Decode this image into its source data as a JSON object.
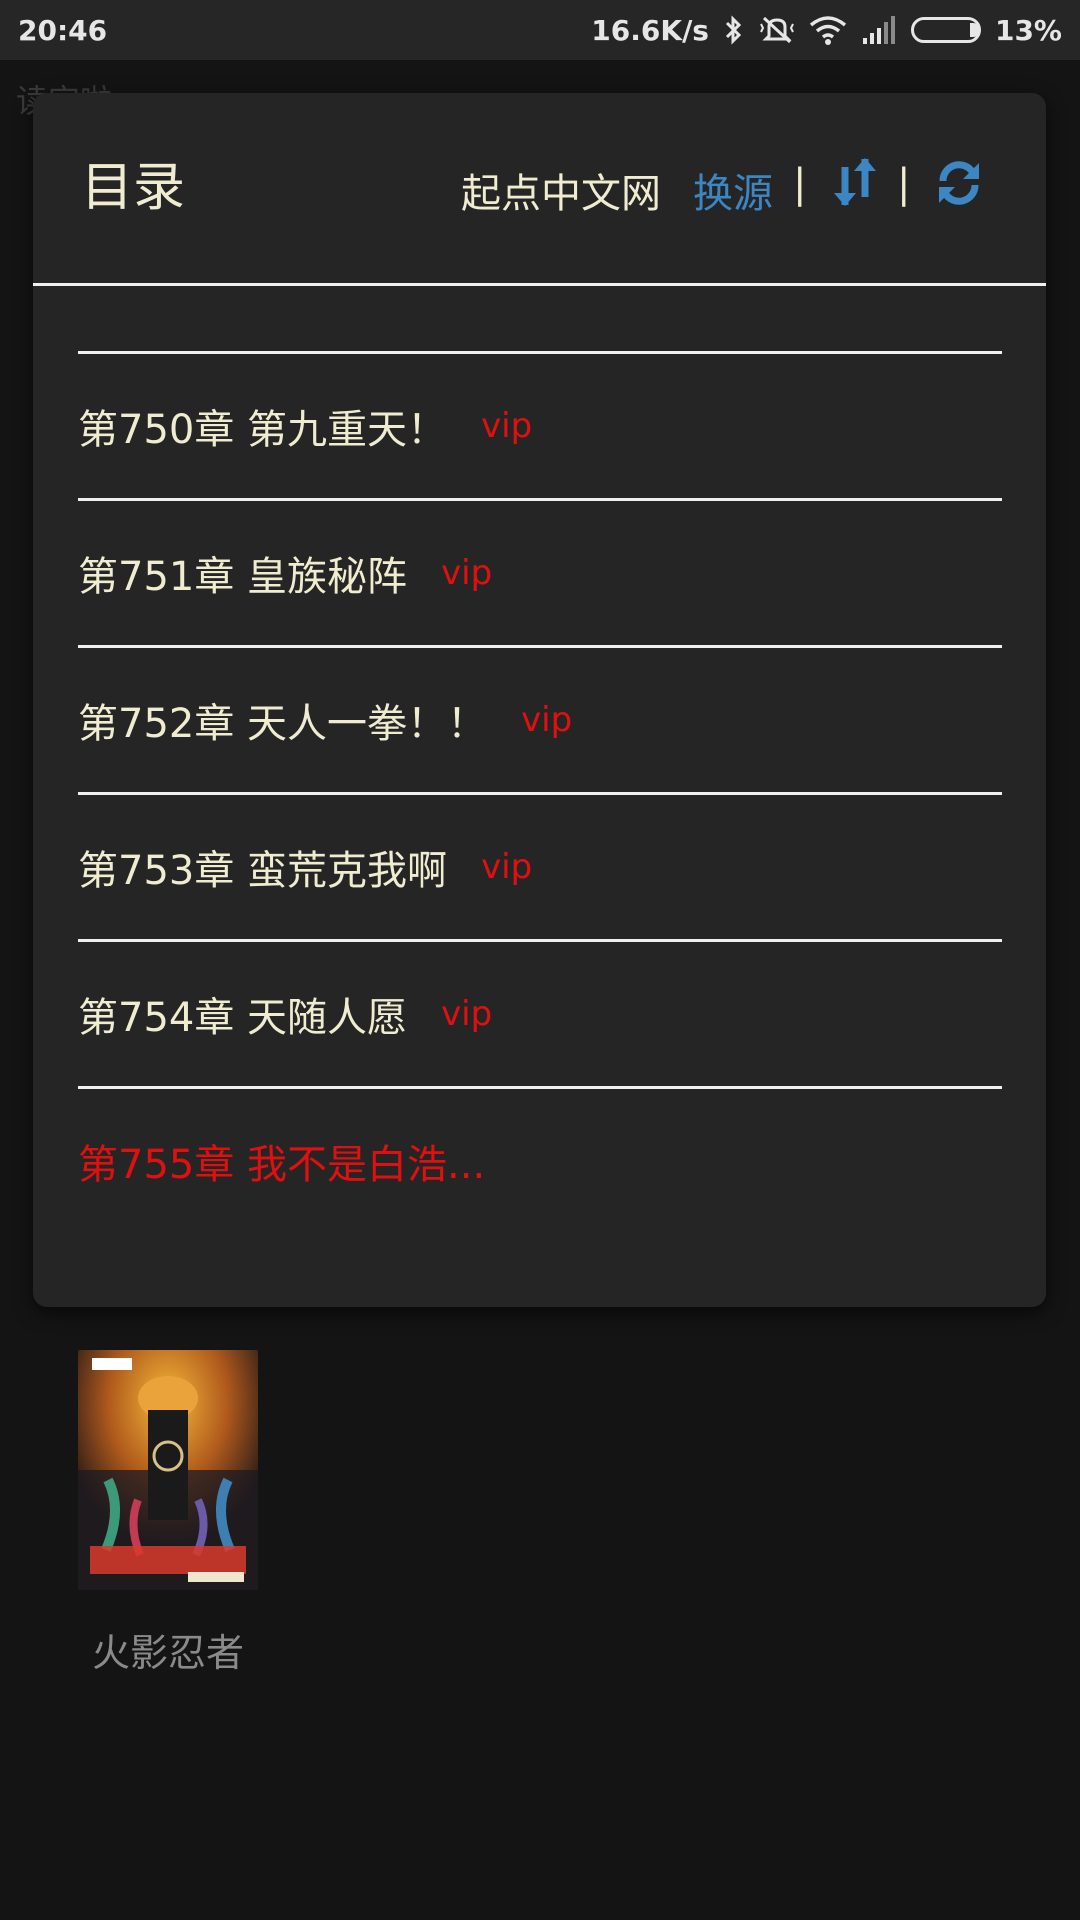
{
  "status_bar": {
    "time": "20:46",
    "net_speed": "16.6K/s",
    "battery": "13%"
  },
  "background": {
    "page_title": "读完啦",
    "book_title": "火影忍者"
  },
  "dialog": {
    "title": "目录",
    "source_name": "起点中文网",
    "change_source_label": "换源",
    "separator": "|",
    "chapters": [
      {
        "title": "第750章 第九重天！",
        "badge": "vip"
      },
      {
        "title": "第751章 皇族秘阵",
        "badge": "vip"
      },
      {
        "title": "第752章 天人一拳！！",
        "badge": "vip"
      },
      {
        "title": "第753章 蛮荒克我啊",
        "badge": "vip"
      },
      {
        "title": "第754章 天随人愿",
        "badge": "vip"
      },
      {
        "title": "第755章 我不是白浩...",
        "badge": ""
      }
    ]
  },
  "colors": {
    "accent_blue": "#3d86c4",
    "vip_red": "#e01010",
    "text_cream": "#f0ecd0",
    "dialog_bg": "#252525"
  }
}
